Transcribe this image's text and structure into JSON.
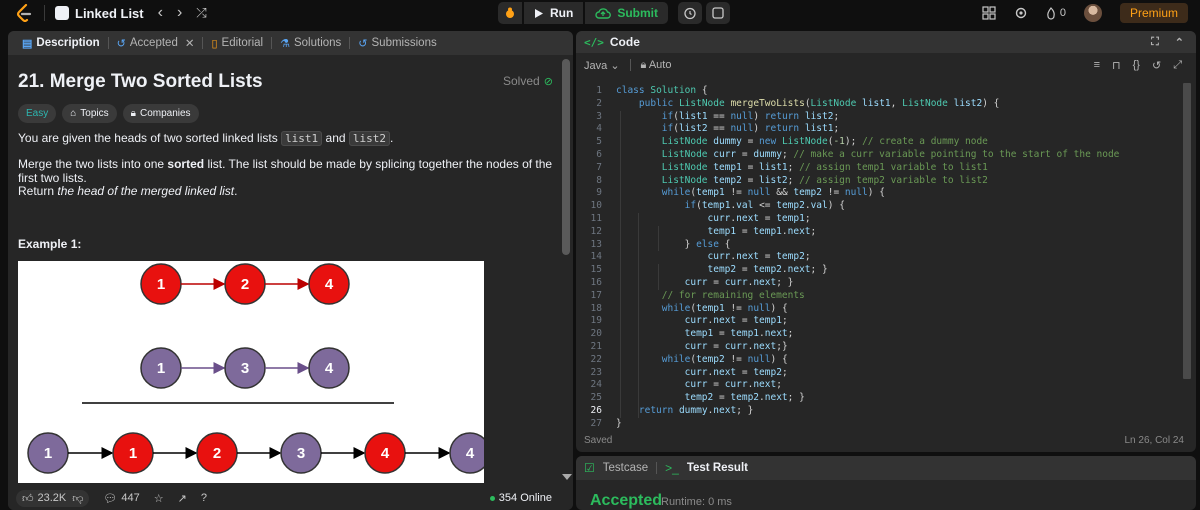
{
  "topbar": {
    "problem_list": "Linked List",
    "run_label": "Run",
    "submit_label": "Submit",
    "streak_count": "0",
    "premium_label": "Premium"
  },
  "left_tabs": [
    {
      "label": "Description",
      "icon": "description-icon"
    },
    {
      "label": "Accepted",
      "icon": "history-icon"
    },
    {
      "label": "Editorial",
      "icon": "book-icon"
    },
    {
      "label": "Solutions",
      "icon": "flask-icon"
    },
    {
      "label": "Submissions",
      "icon": "history-icon"
    }
  ],
  "problem": {
    "title": "21. Merge Two Sorted Lists",
    "status": "Solved",
    "difficulty": "Easy",
    "topics_label": "Topics",
    "companies_label": "Companies",
    "p1_before": "You are given the heads of two sorted linked lists ",
    "p1_code1": "list1",
    "p1_mid": " and ",
    "p1_code2": "list2",
    "p1_after": ".",
    "p2_before": "Merge the two lists into one ",
    "p2_bold": "sorted",
    "p2_after": " list. The list should be made by splicing together the nodes of the first two lists.",
    "p3_before": "Return ",
    "p3_italic": "the head of the merged linked list",
    "p3_after": ".",
    "example_heading": "Example 1:"
  },
  "diagram": {
    "list1": [
      "1",
      "2",
      "4"
    ],
    "list2": [
      "1",
      "3",
      "4"
    ],
    "merged": [
      "1",
      "1",
      "2",
      "3",
      "4",
      "4"
    ],
    "merged_colors": [
      "purple",
      "red",
      "red",
      "purple",
      "red",
      "purple"
    ],
    "red": "#e8110f",
    "purple": "#7e6a9b"
  },
  "footer": {
    "likes": "23.2K",
    "comments": "447",
    "online": "354 Online"
  },
  "code": {
    "header": "Code",
    "tag": "</>",
    "language": "Java",
    "mode": "Auto",
    "current_line": 26,
    "lines": [
      "class Solution {",
      "    public ListNode mergeTwoLists(ListNode list1, ListNode list2) {",
      "        if(list1 == null) return list2;",
      "        if(list2 == null) return list1;",
      "        ListNode dummy = new ListNode(-1); // create a dummy node",
      "        ListNode curr = dummy; // make a curr variable pointing to the start of the node",
      "        ListNode temp1 = list1; // assign temp1 variable to list1",
      "        ListNode temp2 = list2; // assign temp2 variable to list2",
      "        while(temp1 != null && temp2 != null) {",
      "            if(temp1.val <= temp2.val) {",
      "                curr.next = temp1;",
      "                temp1 = temp1.next;",
      "            } else {",
      "                curr.next = temp2;",
      "                temp2 = temp2.next; }",
      "            curr = curr.next; }",
      "        // for remaining elements",
      "        while(temp1 != null) {",
      "            curr.next = temp1;",
      "            temp1 = temp1.next;",
      "            curr = curr.next;}",
      "        while(temp2 != null) {",
      "            curr.next = temp2;",
      "            curr = curr.next;",
      "            temp2 = temp2.next; }",
      "    return dummy.next; }",
      "}"
    ],
    "saved": "Saved",
    "cursor": "Ln 26, Col 24"
  },
  "test": {
    "testcase_label": "Testcase",
    "result_label": "Test Result",
    "status": "Accepted",
    "runtime": "Runtime: 0 ms"
  }
}
